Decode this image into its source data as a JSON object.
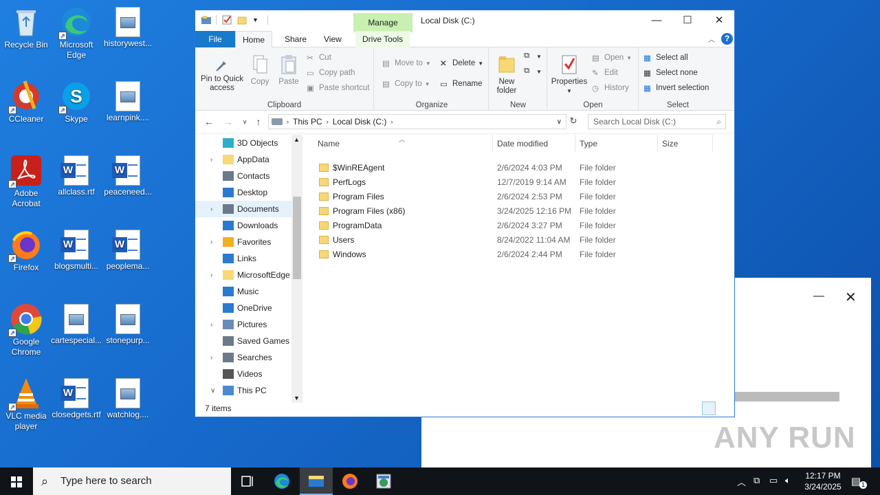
{
  "desktop": {
    "icons": [
      {
        "label": "Recycle Bin"
      },
      {
        "label": "Microsoft Edge"
      },
      {
        "label": "historywest..."
      },
      {
        "label": "CCleaner"
      },
      {
        "label": "Skype"
      },
      {
        "label": "learnpink...."
      },
      {
        "label": "Adobe Acrobat"
      },
      {
        "label": "allclass.rtf"
      },
      {
        "label": "peaceneed..."
      },
      {
        "label": "Firefox"
      },
      {
        "label": "blogsmulti..."
      },
      {
        "label": "peoplema..."
      },
      {
        "label": "Google Chrome"
      },
      {
        "label": "cartespecial..."
      },
      {
        "label": "stonepurp..."
      },
      {
        "label": "VLC media player"
      },
      {
        "label": "closedgets.rtf"
      },
      {
        "label": "watchlog...."
      }
    ]
  },
  "explorer": {
    "title": "Local Disk (C:)",
    "manage_tab": "Manage",
    "drive_tools_tab": "Drive Tools",
    "tabs": [
      "File",
      "Home",
      "Share",
      "View"
    ],
    "ribbon": {
      "clipboard": {
        "label": "Clipboard",
        "pin": "Pin to Quick access",
        "copy": "Copy",
        "paste": "Paste",
        "cut": "Cut",
        "copy_path": "Copy path",
        "paste_shortcut": "Paste shortcut"
      },
      "organize": {
        "label": "Organize",
        "move_to": "Move to",
        "copy_to": "Copy to",
        "delete": "Delete",
        "rename": "Rename"
      },
      "new": {
        "label": "New",
        "new_folder": "New folder"
      },
      "open": {
        "label": "Open",
        "properties": "Properties",
        "open": "Open",
        "edit": "Edit",
        "history": "History"
      },
      "select": {
        "label": "Select",
        "select_all": "Select all",
        "select_none": "Select none",
        "invert": "Invert selection"
      }
    },
    "address": {
      "crumbs": [
        "This PC",
        "Local Disk (C:)"
      ],
      "search_placeholder": "Search Local Disk (C:)"
    },
    "nav_items": [
      {
        "label": "3D Objects",
        "expandable": false
      },
      {
        "label": "AppData",
        "expandable": true
      },
      {
        "label": "Contacts",
        "expandable": false
      },
      {
        "label": "Desktop",
        "expandable": false
      },
      {
        "label": "Documents",
        "expandable": true,
        "selected": true
      },
      {
        "label": "Downloads",
        "expandable": false
      },
      {
        "label": "Favorites",
        "expandable": true
      },
      {
        "label": "Links",
        "expandable": false
      },
      {
        "label": "MicrosoftEdge",
        "expandable": true
      },
      {
        "label": "Music",
        "expandable": false
      },
      {
        "label": "OneDrive",
        "expandable": false
      },
      {
        "label": "Pictures",
        "expandable": true
      },
      {
        "label": "Saved Games",
        "expandable": false
      },
      {
        "label": "Searches",
        "expandable": true
      },
      {
        "label": "Videos",
        "expandable": false
      },
      {
        "label": "This PC",
        "expandable": true,
        "expanded": true
      }
    ],
    "columns": [
      "Name",
      "Date modified",
      "Type",
      "Size"
    ],
    "files": [
      {
        "name": "$WinREAgent",
        "date": "2/6/2024 4:03 PM",
        "type": "File folder"
      },
      {
        "name": "PerfLogs",
        "date": "12/7/2019 9:14 AM",
        "type": "File folder"
      },
      {
        "name": "Program Files",
        "date": "2/6/2024 2:53 PM",
        "type": "File folder"
      },
      {
        "name": "Program Files (x86)",
        "date": "3/24/2025 12:16 PM",
        "type": "File folder"
      },
      {
        "name": "ProgramData",
        "date": "2/6/2024 3:27 PM",
        "type": "File folder"
      },
      {
        "name": "Users",
        "date": "8/24/2022 11:04 AM",
        "type": "File folder"
      },
      {
        "name": "Windows",
        "date": "2/6/2024 2:44 PM",
        "type": "File folder"
      }
    ],
    "status": "7 items"
  },
  "watermark": "ANY RUN",
  "taskbar": {
    "search_placeholder": "Type here to search",
    "time": "12:17 PM",
    "date": "3/24/2025",
    "notifications": "1"
  },
  "colors": {
    "accent": "#1979ca",
    "desktop": "#1565c6",
    "manage_tab": "#c8f0b0"
  }
}
